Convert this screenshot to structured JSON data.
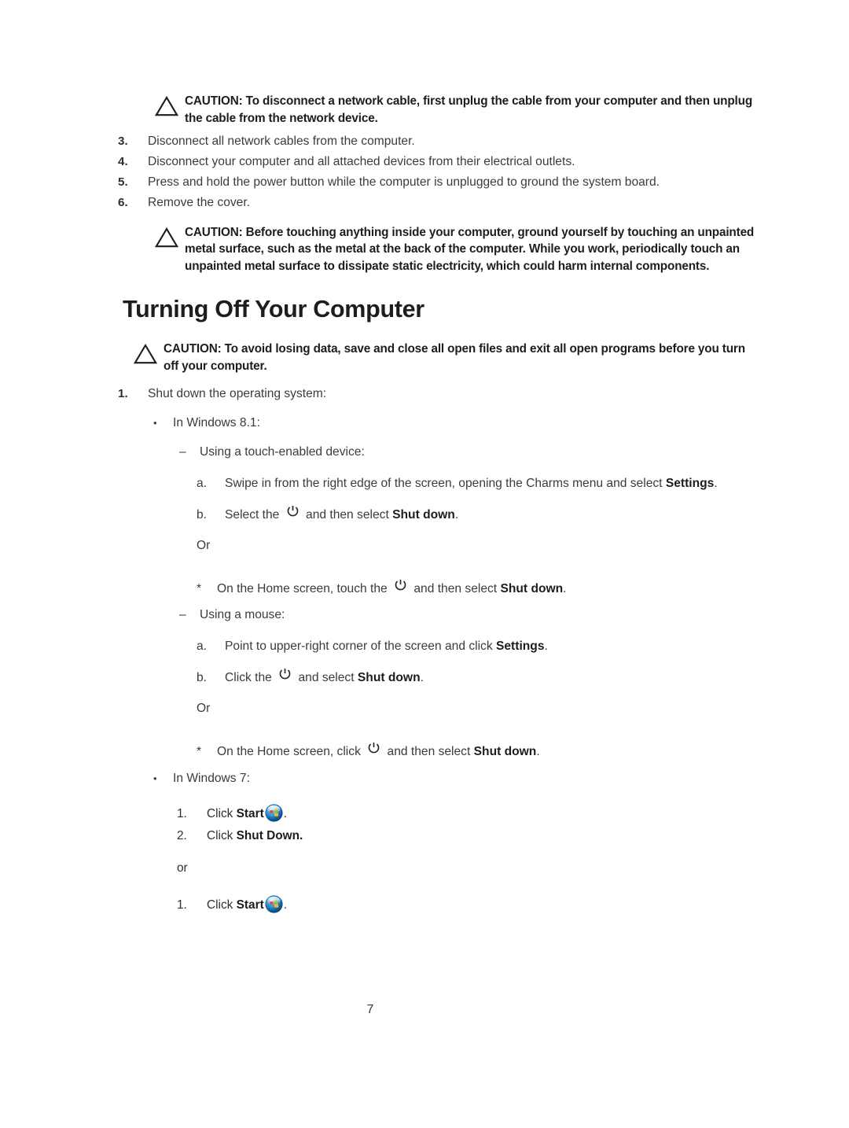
{
  "document": {
    "page_number": "7",
    "text_color": "#3b3b3b",
    "heading_color": "#1d1d1d"
  },
  "cautions": {
    "network_cable": "CAUTION: To disconnect a network cable, first unplug the cable from your computer and then unplug the cable from the network device.",
    "grounding": "CAUTION: Before touching anything inside your computer, ground yourself by touching an unpainted metal surface, such as the metal at the back of the computer. While you work, periodically touch an unpainted metal surface to dissipate static electricity, which could harm internal components.",
    "losing_data": "CAUTION: To avoid losing data, save and close all open files and exit all open programs before you turn off your computer."
  },
  "before_steps": [
    {
      "num": "3.",
      "text": "Disconnect all network cables from the computer."
    },
    {
      "num": "4.",
      "text": "Disconnect your computer and all attached devices from their electrical outlets."
    },
    {
      "num": "5.",
      "text": "Press and hold the power button while the computer is unplugged to ground the system board."
    },
    {
      "num": "6.",
      "text": "Remove the cover."
    }
  ],
  "section": {
    "title": "Turning Off Your Computer",
    "step1_num": "1.",
    "step1_text": "Shut down the operating system:"
  },
  "windows81": {
    "bullet": "•",
    "label": "In Windows 8.1:",
    "touch": {
      "dash": "–",
      "label": "Using a touch-enabled device:",
      "a_mark": "a.",
      "a_text_pre": "Swipe in from the right edge of the screen, opening the Charms menu and select ",
      "a_bold": "Settings",
      "a_text_post": ".",
      "b_mark": "b.",
      "b_text_pre": "Select the ",
      "b_text_mid": " and then select ",
      "b_bold": "Shut down",
      "b_text_post": ".",
      "or": "Or",
      "star_mark": "*",
      "star_text_pre": "On the Home screen, touch the ",
      "star_text_mid": " and then select ",
      "star_bold": "Shut down",
      "star_text_post": "."
    },
    "mouse": {
      "dash": "–",
      "label": "Using a mouse:",
      "a_mark": "a.",
      "a_text_pre": "Point to upper-right corner of the screen and click ",
      "a_bold": "Settings",
      "a_text_post": ".",
      "b_mark": "b.",
      "b_text_pre": "Click the ",
      "b_text_mid": " and select ",
      "b_bold": "Shut down",
      "b_text_post": ".",
      "or": "Or",
      "star_mark": "*",
      "star_text_pre": "On the Home screen, click ",
      "star_text_mid": " and then select ",
      "star_bold": "Shut down",
      "star_text_post": "."
    }
  },
  "windows7": {
    "bullet": "•",
    "label": "In Windows 7:",
    "step1_mark": "1.",
    "step1_pre": "Click ",
    "step1_bold": "Start",
    "step1_post": ".",
    "step2_mark": "2.",
    "step2_pre": "Click ",
    "step2_bold": "Shut Down.",
    "or": "or",
    "alt1_mark": "1.",
    "alt1_pre": "Click ",
    "alt1_bold": "Start",
    "alt1_post": "."
  },
  "icons": {
    "caution": "warning-triangle-icon",
    "power": "power-icon",
    "start_orb": "windows-start-orb-icon"
  }
}
